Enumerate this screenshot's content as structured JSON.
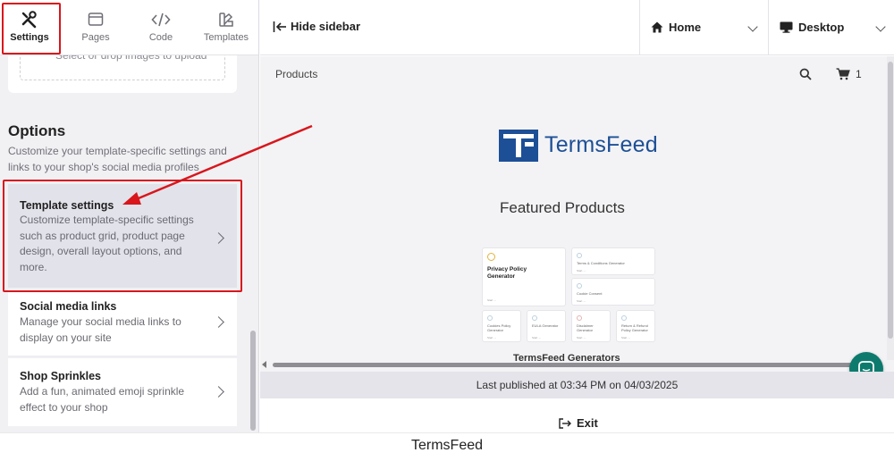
{
  "nav": {
    "settings_label": "Settings",
    "pages_label": "Pages",
    "code_label": "Code",
    "templates_label": "Templates",
    "active": "settings"
  },
  "sidebar": {
    "upload_text": "Select or drop images to upload",
    "options_title": "Options",
    "options_desc": "Customize your template-specific settings and links to your shop's social media profiles",
    "items": [
      {
        "title": "Template settings",
        "desc": "Customize template-specific settings such as product grid, product page design, overall layout options, and more."
      },
      {
        "title": "Social media links",
        "desc": "Manage your social media links to display on your site"
      },
      {
        "title": "Shop Sprinkles",
        "desc": "Add a fun, animated emoji sprinkle effect to your shop"
      }
    ]
  },
  "topbar": {
    "hide_sidebar": "Hide sidebar",
    "page_select": "Home",
    "device_select": "Desktop"
  },
  "preview": {
    "nav_products": "Products",
    "cart_count": "1",
    "brand_name": "TermsFeed",
    "featured_title": "Featured Products",
    "big_card_title": "Privacy Policy Generator",
    "mini_cards": [
      "Terms & Conditions Generator",
      "Cookie Consent",
      "Cookies Policy Generator",
      "EULA Generator",
      "Disclaimer Generator",
      "Return & Refund Policy Generator"
    ],
    "mini_link": "Start →",
    "generators_partial": "TermsFeed Generators"
  },
  "status": {
    "last_published": "Last published at 03:34 PM on 04/03/2025",
    "exit_label": "Exit"
  },
  "caption": "TermsFeed",
  "colors": {
    "annotation_red": "#d8161c",
    "brand_blue": "#1d4f96",
    "chat_green": "#0d7a6e"
  }
}
